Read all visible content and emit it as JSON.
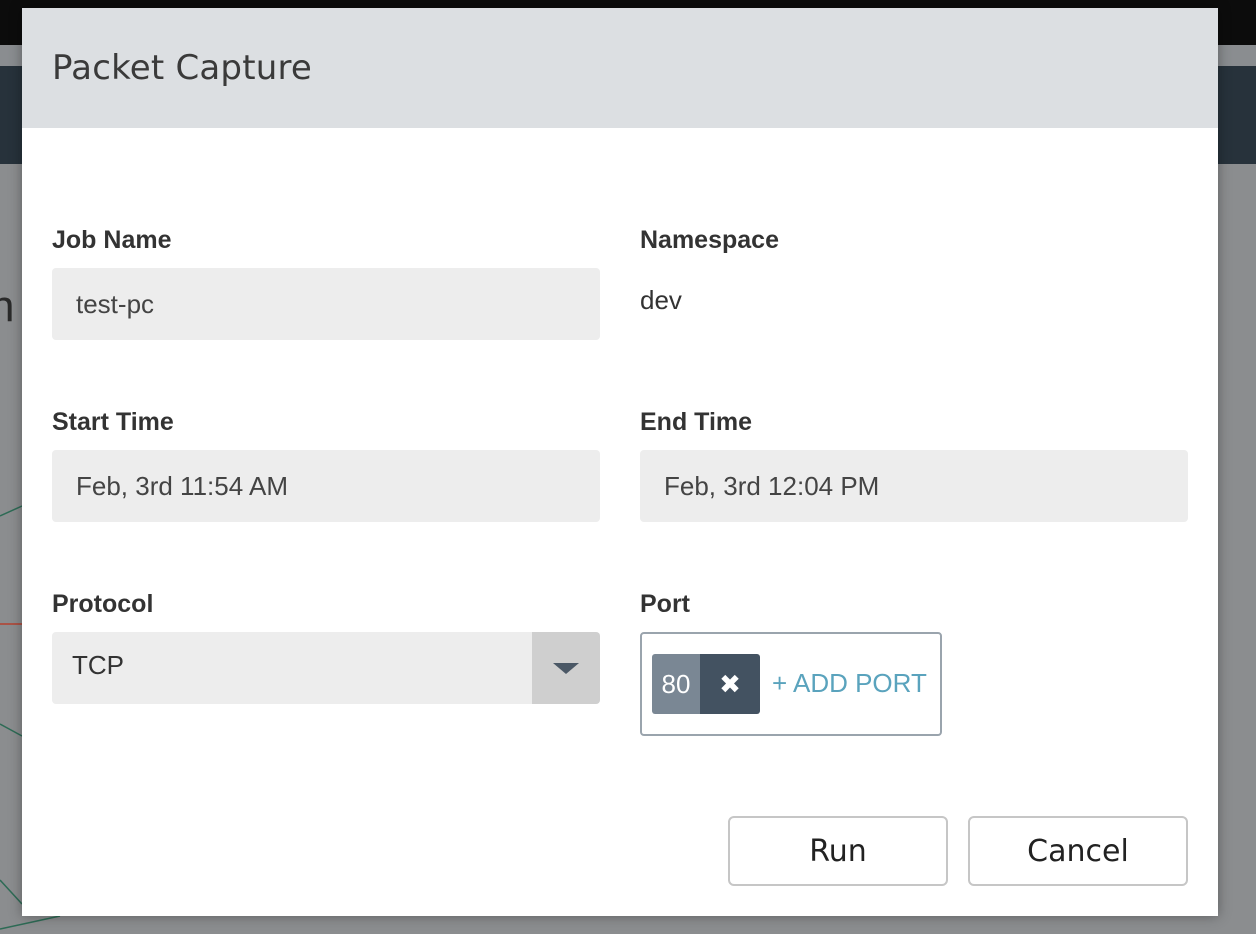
{
  "background": {
    "partial_text": "h"
  },
  "modal": {
    "title": "Packet Capture",
    "fields": {
      "job_name": {
        "label": "Job Name",
        "value": "test-pc"
      },
      "namespace": {
        "label": "Namespace",
        "value": "dev"
      },
      "start_time": {
        "label": "Start Time",
        "value": "Feb, 3rd 11:54 AM"
      },
      "end_time": {
        "label": "End Time",
        "value": "Feb, 3rd 12:04 PM"
      },
      "protocol": {
        "label": "Protocol",
        "value": "TCP"
      },
      "port": {
        "label": "Port",
        "tags": [
          "80"
        ],
        "remove_glyph": "✖",
        "add_label": "+ ADD PORT"
      }
    },
    "buttons": {
      "run": "Run",
      "cancel": "Cancel"
    }
  },
  "colors": {
    "header_bg": "#dcdfe2",
    "input_bg": "#ededed",
    "port_tag_value": "#7a8794",
    "port_tag_remove": "#435261",
    "add_port_link": "#5aa3bd"
  }
}
